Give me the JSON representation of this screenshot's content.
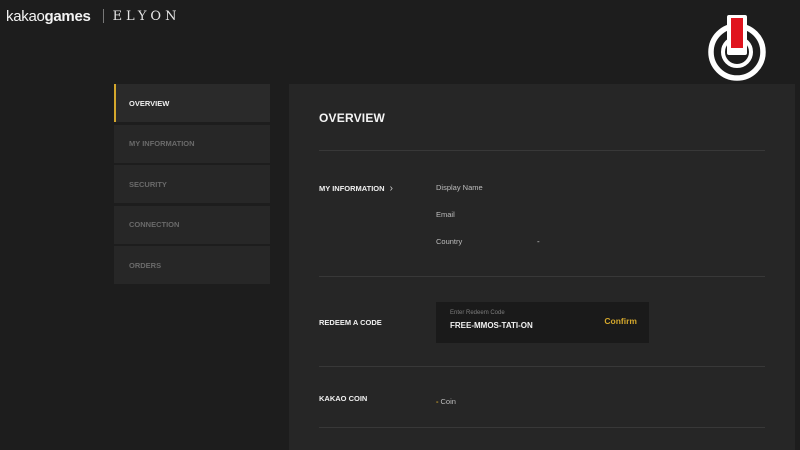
{
  "header": {
    "brand_kakao_prefix": "kakao",
    "brand_kakao_suffix": "games",
    "brand_game": "ELYON",
    "power_icon": "power-icon"
  },
  "sidebar": {
    "items": [
      {
        "label": "OVERVIEW",
        "active": true
      },
      {
        "label": "MY INFORMATION",
        "active": false
      },
      {
        "label": "SECURITY",
        "active": false
      },
      {
        "label": "CONNECTION",
        "active": false
      },
      {
        "label": "ORDERS",
        "active": false
      }
    ]
  },
  "overview": {
    "title": "OVERVIEW",
    "my_information": {
      "label": "MY INFORMATION",
      "chevron": "›",
      "fields": [
        {
          "label": "Display Name",
          "value": ""
        },
        {
          "label": "Email",
          "value": ""
        },
        {
          "label": "Country",
          "value": "-"
        }
      ]
    },
    "redeem": {
      "label": "REDEEM A CODE",
      "placeholder": "Enter Redeem Code",
      "value": "FREE-MMOS-TATI-ON",
      "confirm_label": "Confirm"
    },
    "kakao_coin": {
      "label": "KAKAO COIN",
      "amount": "-",
      "unit": "Coin"
    }
  },
  "colors": {
    "accent": "#d4a72c",
    "power_red": "#e0141e",
    "background": "#1d1d1d",
    "panel": "#262626"
  }
}
